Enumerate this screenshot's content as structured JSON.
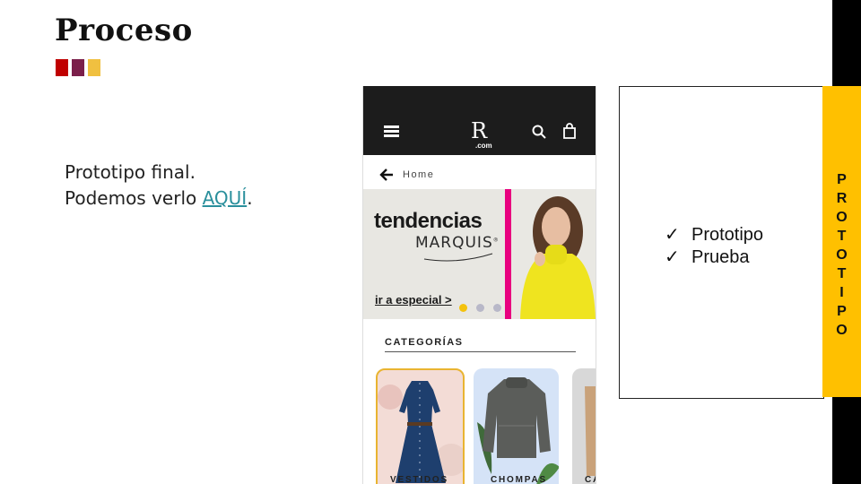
{
  "slide": {
    "title": "Proceso",
    "colors": {
      "accent_red": "#c00000",
      "accent_purple": "#7b1f4a",
      "accent_yellow": "#f0c040",
      "bar": "#ffc000"
    },
    "body_line1": "Prototipo final.",
    "body_line2_prefix": "Podemos verlo ",
    "body_link": "AQUÍ",
    "body_line2_suffix": "."
  },
  "phone": {
    "logo": "R",
    "logo_sub": ".com",
    "breadcrumb": "Home",
    "banner": {
      "title": "tendencias",
      "brand": "MARQUIS",
      "brand_mark": "®",
      "link": "ir a especial >"
    },
    "categories_title": "CATEGORÍAS",
    "categories": [
      "VESTIDOS",
      "CHOMPAS",
      "CA"
    ]
  },
  "panel": {
    "items": [
      "Prototipo",
      "Prueba"
    ],
    "check_mark": "✓",
    "vertical_label": [
      "P",
      "R",
      "O",
      "T",
      "O",
      "T",
      "I",
      "P",
      "O"
    ]
  }
}
